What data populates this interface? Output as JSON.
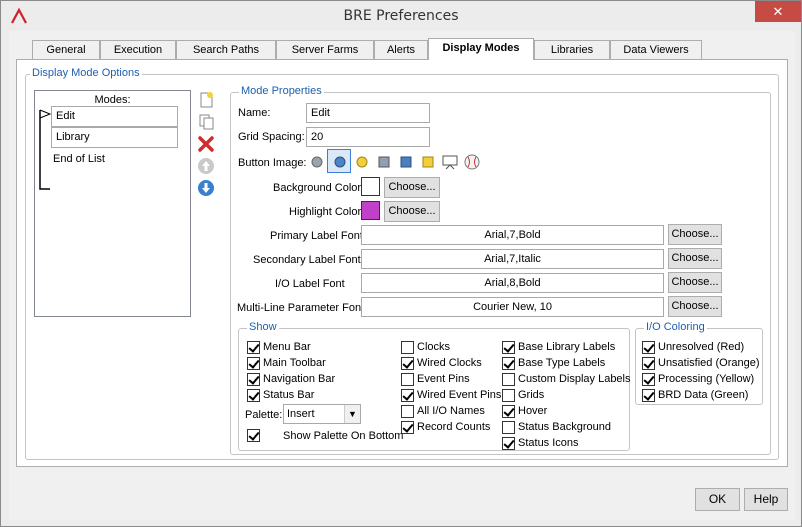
{
  "window": {
    "title": "BRE Preferences",
    "close_glyph": "✕"
  },
  "tabs": [
    {
      "label": "General"
    },
    {
      "label": "Execution"
    },
    {
      "label": "Search Paths"
    },
    {
      "label": "Server Farms"
    },
    {
      "label": "Alerts"
    },
    {
      "label": "Display Modes"
    },
    {
      "label": "Libraries"
    },
    {
      "label": "Data Viewers"
    }
  ],
  "display_mode_options": {
    "group_label": "Display Mode Options",
    "modes_header": "Modes:",
    "modes": [
      "Edit",
      "Library",
      "End of List"
    ],
    "side_icons": [
      "new-page-icon",
      "copy-icon",
      "delete-icon",
      "move-up-icon",
      "move-down-icon"
    ]
  },
  "mode_properties": {
    "group_label": "Mode Properties",
    "name_label": "Name:",
    "name_value": "Edit",
    "grid_label": "Grid Spacing:",
    "grid_value": "20",
    "button_image_label": "Button Image:",
    "bg_color_label": "Background Color",
    "bg_color": "#ffffff",
    "highlight_color_label": "Highlight Color",
    "highlight_color": "#c040c8",
    "choose": "Choose...",
    "primary_font_label": "Primary Label Font",
    "primary_font": "Arial,7,Bold",
    "secondary_font_label": "Secondary Label Font",
    "secondary_font": "Arial,7,Italic",
    "io_font_label": "I/O Label Font",
    "io_font": "Arial,8,Bold",
    "multiline_font_label": "Multi-Line Parameter Font",
    "multiline_font": "Courier New, 10"
  },
  "show": {
    "group_label": "Show",
    "col1": [
      {
        "label": "Menu Bar",
        "checked": true
      },
      {
        "label": "Main Toolbar",
        "checked": true
      },
      {
        "label": "Navigation Bar",
        "checked": true
      },
      {
        "label": "Status Bar",
        "checked": true
      }
    ],
    "palette_label": "Palette:",
    "palette_value": "Insert",
    "show_palette_bottom": {
      "label": "Show Palette On Bottom",
      "checked": true
    },
    "col2": [
      {
        "label": "Clocks",
        "checked": false
      },
      {
        "label": "Wired Clocks",
        "checked": true
      },
      {
        "label": "Event Pins",
        "checked": false
      },
      {
        "label": "Wired Event Pins",
        "checked": true
      },
      {
        "label": "All I/O Names",
        "checked": false
      },
      {
        "label": "Record Counts",
        "checked": true
      }
    ],
    "col3": [
      {
        "label": "Base Library Labels",
        "checked": true
      },
      {
        "label": "Base Type Labels",
        "checked": true
      },
      {
        "label": "Custom Display Labels",
        "checked": false
      },
      {
        "label": "Grids",
        "checked": false
      },
      {
        "label": "Hover",
        "checked": true
      },
      {
        "label": "Status Background",
        "checked": false
      },
      {
        "label": "Status Icons",
        "checked": true
      }
    ]
  },
  "io_coloring": {
    "group_label": "I/O Coloring",
    "items": [
      {
        "label": "Unresolved (Red)",
        "checked": true
      },
      {
        "label": "Unsatisfied (Orange)",
        "checked": true
      },
      {
        "label": "Processing (Yellow)",
        "checked": true
      },
      {
        "label": "BRD Data (Green)",
        "checked": true
      }
    ]
  },
  "dialog": {
    "ok": "OK",
    "help": "Help"
  }
}
